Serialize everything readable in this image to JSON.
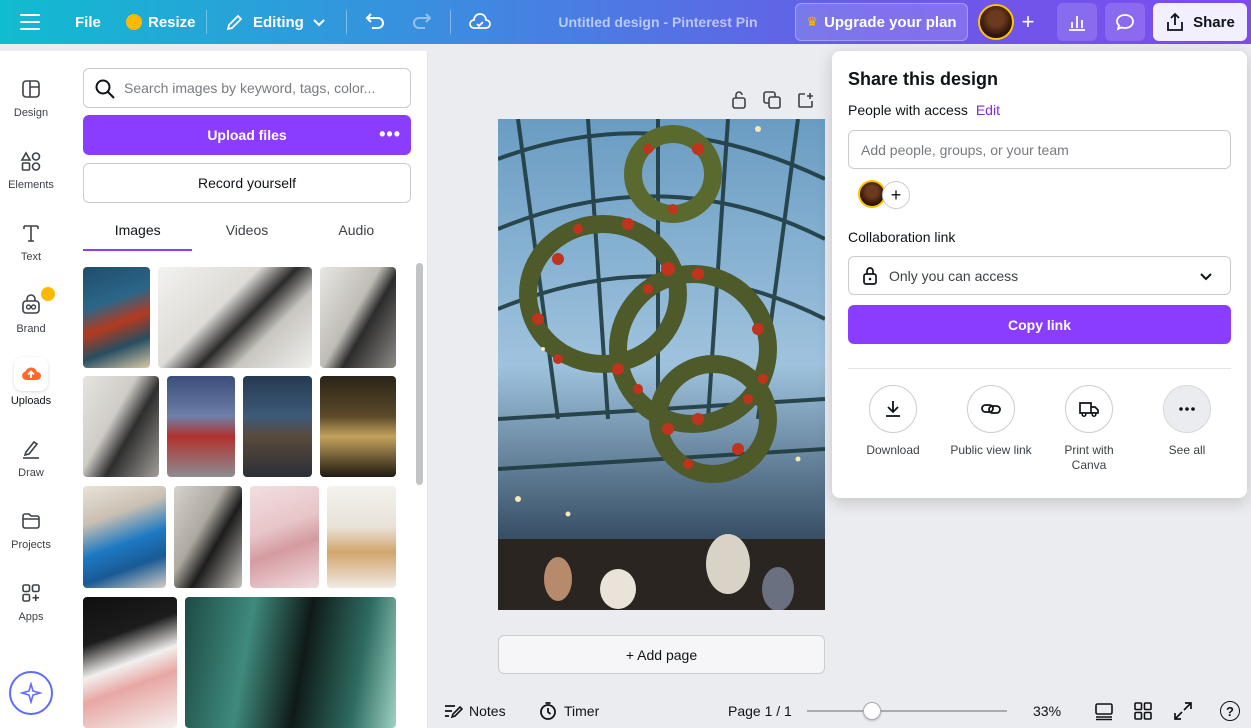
{
  "topbar": {
    "file_label": "File",
    "resize_label": "Resize",
    "editing_label": "Editing",
    "doc_title": "Untitled design - Pinterest Pin",
    "upgrade_label": "Upgrade your plan",
    "share_label": "Share"
  },
  "rail": {
    "items": [
      {
        "label": "Design",
        "icon": "design-icon"
      },
      {
        "label": "Elements",
        "icon": "elements-icon"
      },
      {
        "label": "Text",
        "icon": "text-icon"
      },
      {
        "label": "Brand",
        "icon": "brand-icon"
      },
      {
        "label": "Uploads",
        "icon": "uploads-icon"
      },
      {
        "label": "Draw",
        "icon": "draw-icon"
      },
      {
        "label": "Projects",
        "icon": "projects-icon"
      },
      {
        "label": "Apps",
        "icon": "apps-icon"
      }
    ]
  },
  "panel": {
    "search_placeholder": "Search images by keyword, tags, color...",
    "upload_label": "Upload files",
    "record_label": "Record yourself",
    "tabs": [
      "Images",
      "Videos",
      "Audio"
    ]
  },
  "canvas": {
    "add_page_label": "+ Add page"
  },
  "bottombar": {
    "notes_label": "Notes",
    "timer_label": "Timer",
    "page_label": "Page 1 / 1",
    "zoom_label": "33%",
    "help_label": "?",
    "zoom_fraction": 0.33
  },
  "share_panel": {
    "title": "Share this design",
    "people_label": "People with access",
    "edit_label": "Edit",
    "add_people_placeholder": "Add people, groups, or your team",
    "collab_label": "Collaboration link",
    "access_value": "Only you can access",
    "copy_label": "Copy link",
    "actions": [
      {
        "label": "Download",
        "icon": "download-icon"
      },
      {
        "label": "Public view link",
        "icon": "link-icon"
      },
      {
        "label": "Print with Canva",
        "icon": "truck-icon"
      },
      {
        "label": "See all",
        "icon": "more-icon"
      }
    ]
  },
  "colors": {
    "accent": "#8b3dff",
    "edit_link": "#7d2ae8"
  }
}
